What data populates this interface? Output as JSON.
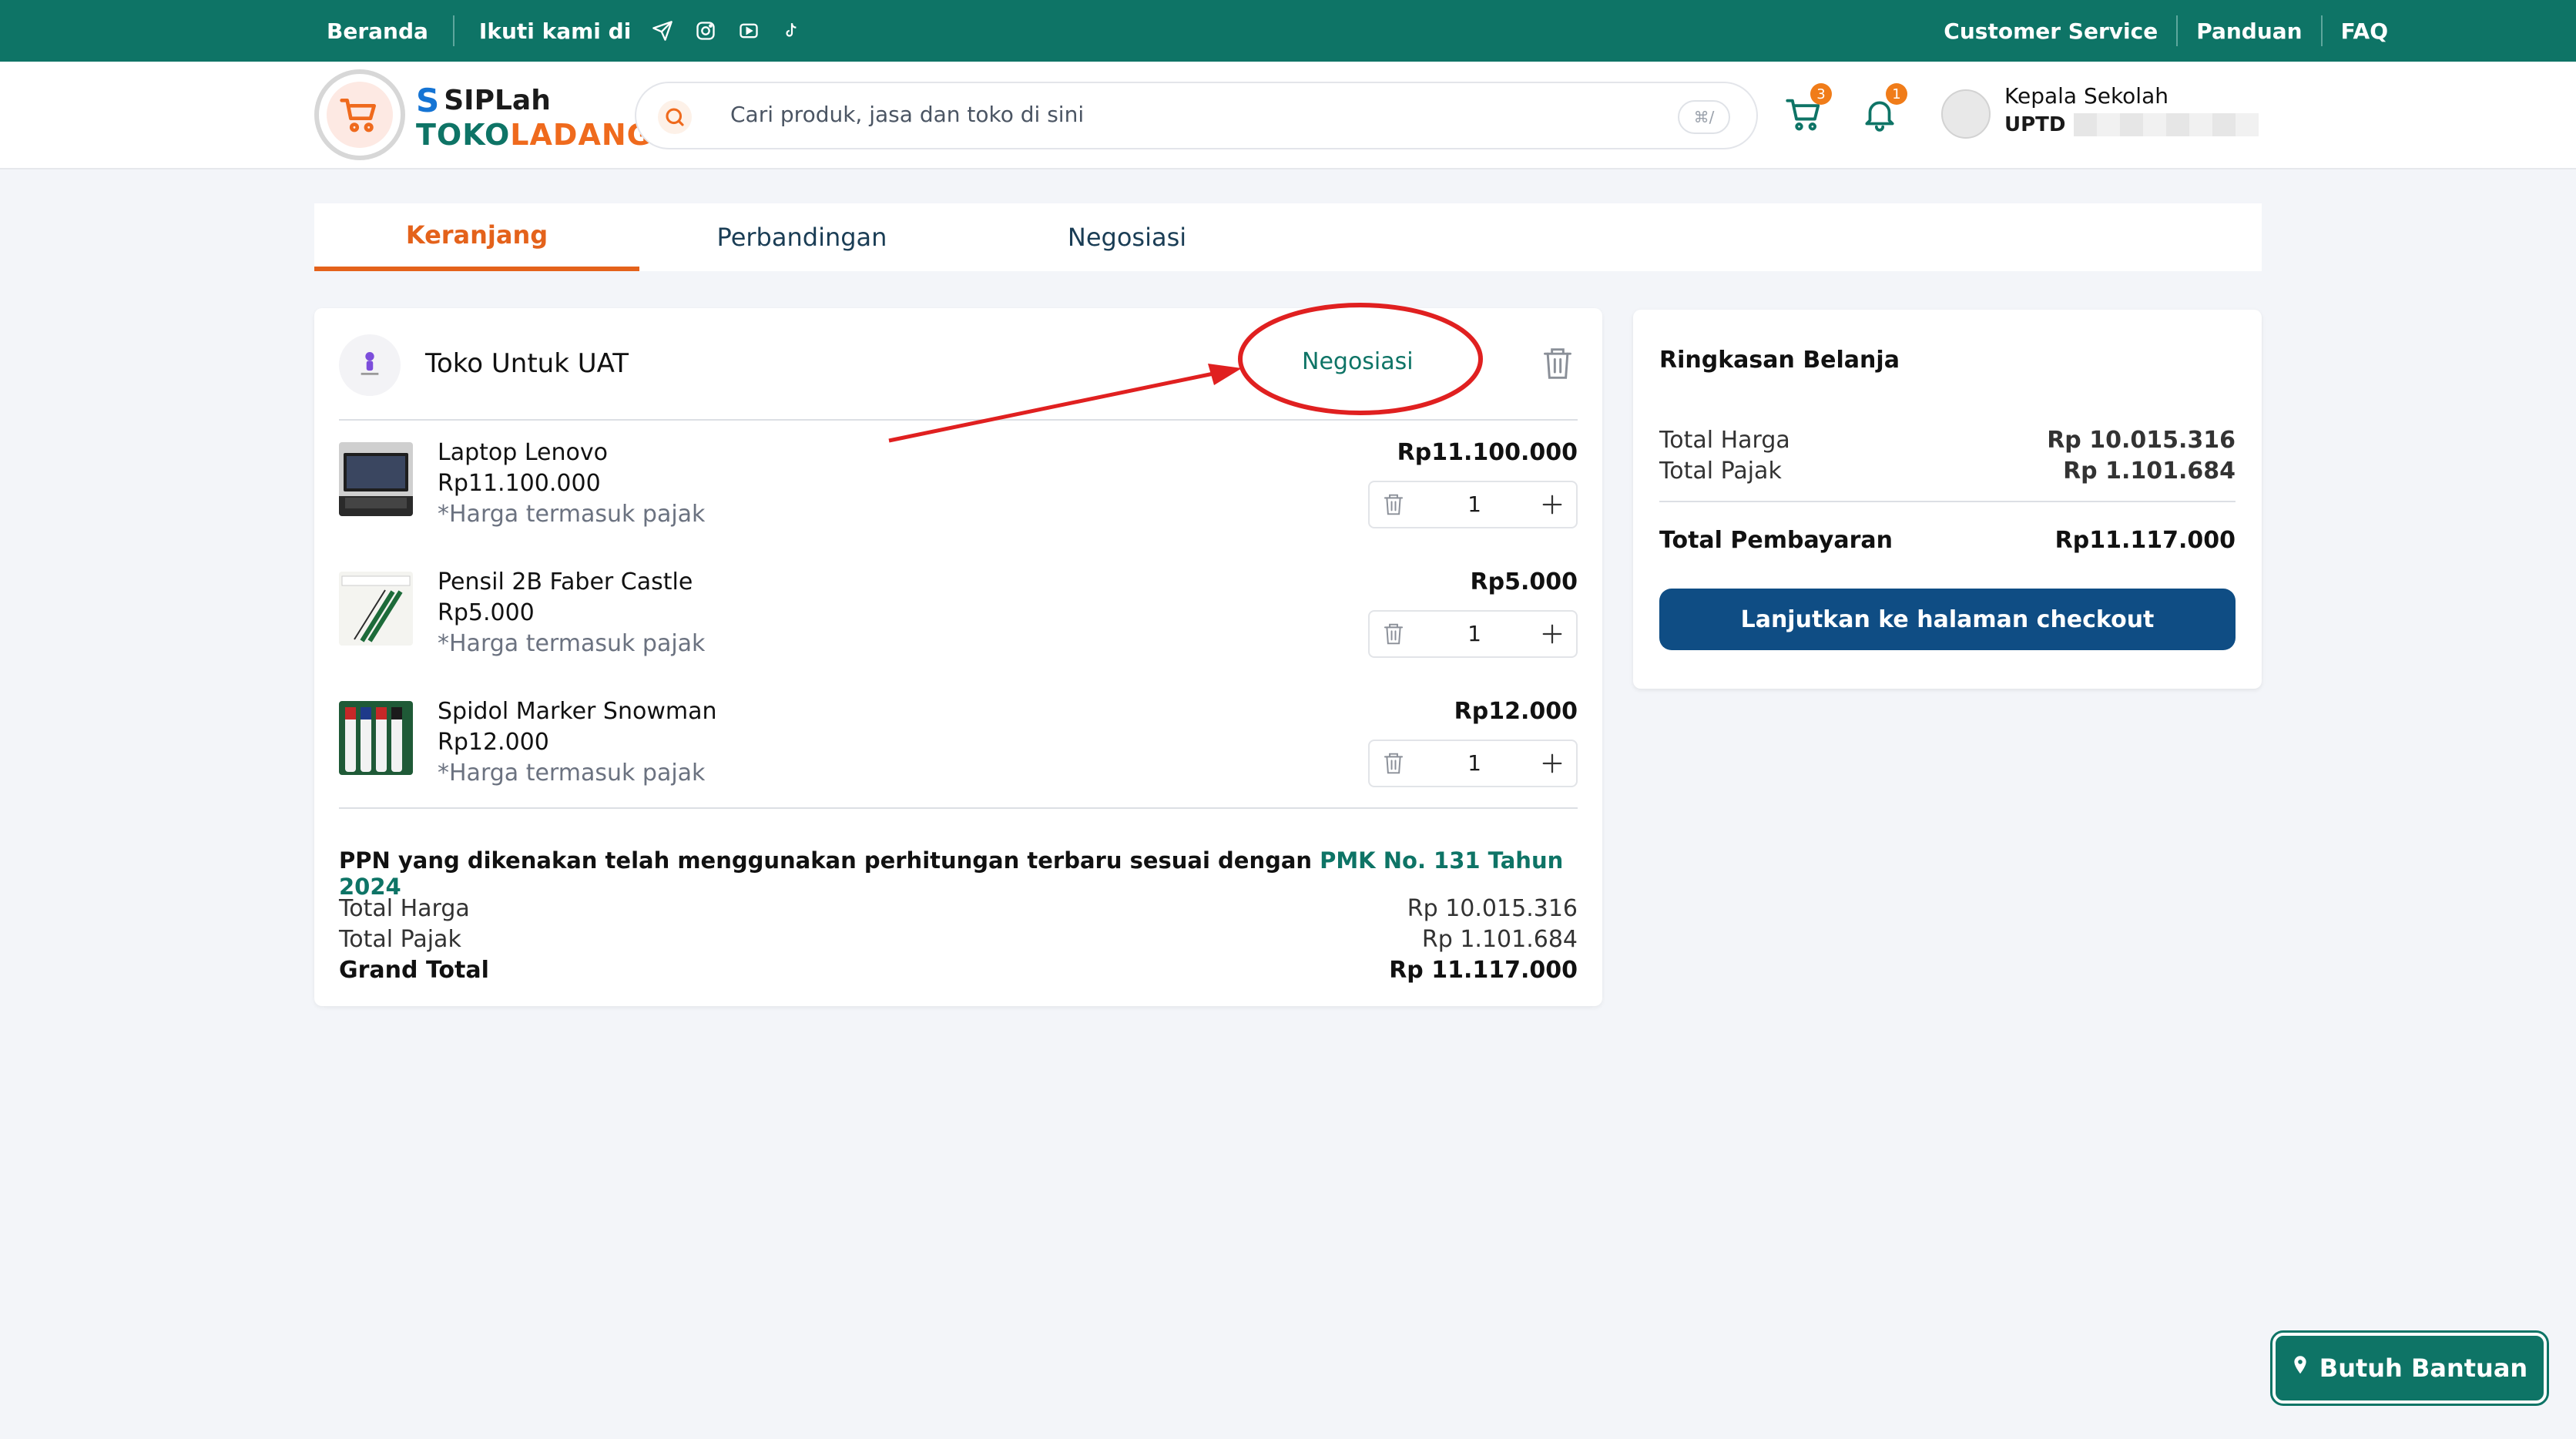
{
  "topbar": {
    "home": "Beranda",
    "follow_label": "Ikuti kami di",
    "social_icons": [
      "telegram-icon",
      "instagram-icon",
      "youtube-icon",
      "tiktok-icon"
    ],
    "customer_service": "Customer Service",
    "guide": "Panduan",
    "faq": "FAQ"
  },
  "header": {
    "brand_top": "SIPLah",
    "brand_bottom_a": "TOKO",
    "brand_bottom_b": "LADANG",
    "search_placeholder": "Cari produk, jasa dan toko di sini",
    "search_shortcut": "⌘/",
    "cart_count": "3",
    "notif_count": "1",
    "user_role": "Kepala Sekolah",
    "user_name": "UPTD"
  },
  "tabs": [
    "Keranjang",
    "Perbandingan",
    "Negosiasi"
  ],
  "cart": {
    "store_name": "Toko Untuk UAT",
    "negotiate_label": "Negosiasi",
    "items": [
      {
        "name": "Laptop Lenovo",
        "price": "Rp11.100.000",
        "tax_note": "*Harga termasuk pajak",
        "total": "Rp11.100.000",
        "qty": "1"
      },
      {
        "name": "Pensil 2B Faber Castle",
        "price": "Rp5.000",
        "tax_note": "*Harga termasuk pajak",
        "total": "Rp5.000",
        "qty": "1"
      },
      {
        "name": "Spidol Marker Snowman",
        "price": "Rp12.000",
        "tax_note": "*Harga termasuk pajak",
        "total": "Rp12.000",
        "qty": "1"
      }
    ],
    "ppn_text": "PPN yang dikenakan telah menggunakan perhitungan terbaru sesuai dengan",
    "ppn_link": "PMK No. 131 Tahun 2024",
    "total_price_label": "Total Harga",
    "total_price": "Rp 10.015.316",
    "total_tax_label": "Total Pajak",
    "total_tax": "Rp 1.101.684",
    "grand_total_label": "Grand Total",
    "grand_total": "Rp 11.117.000"
  },
  "summary": {
    "title": "Ringkasan Belanja",
    "total_price_label": "Total Harga",
    "total_price": "Rp 10.015.316",
    "total_tax_label": "Total Pajak",
    "total_tax": "Rp 1.101.684",
    "total_payment_label": "Total Pembayaran",
    "total_payment": "Rp11.117.000",
    "checkout_label": "Lanjutkan ke halaman checkout"
  },
  "help_label": "Butuh Bantuan",
  "colors": {
    "primary": "#0e7466",
    "accent": "#e4621b",
    "button": "#0f4d84",
    "badge": "#f07c19",
    "annotation": "#e02020"
  }
}
